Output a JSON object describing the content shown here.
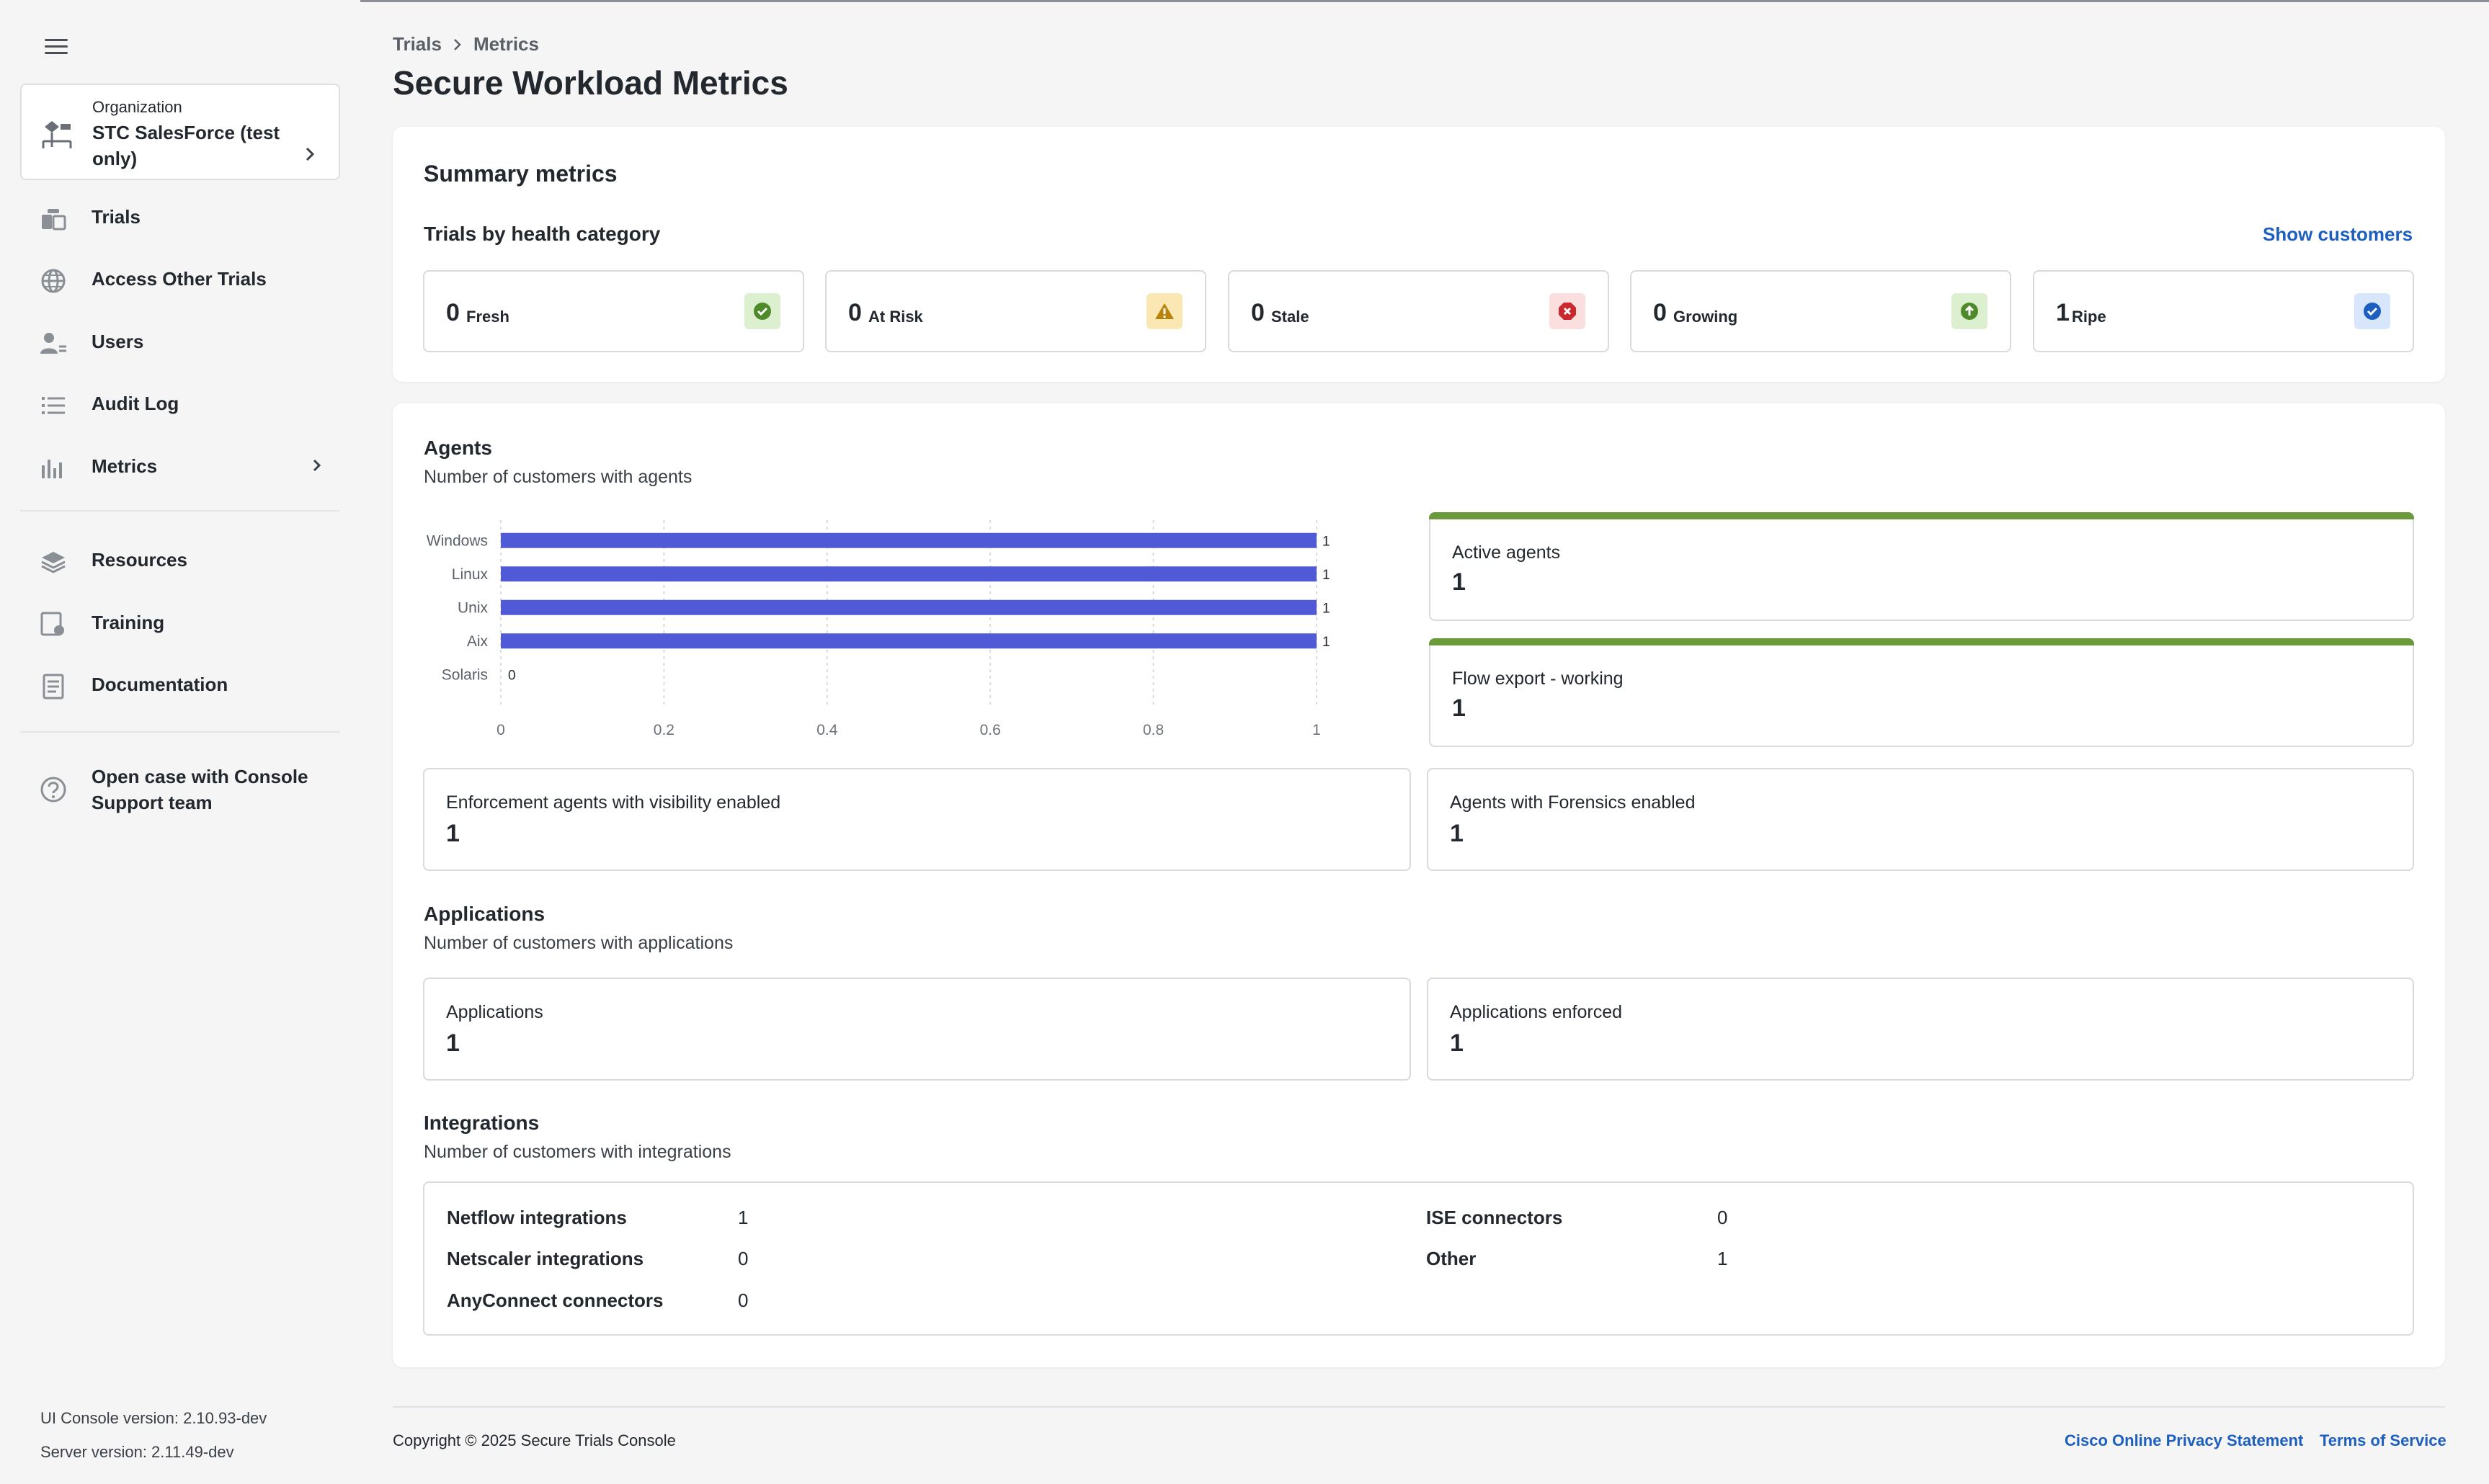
{
  "sidebar": {
    "org_small": "Organization",
    "org_name": "STC SalesForce (test only)",
    "items": [
      {
        "label": "Trials",
        "icon": "trials-icon"
      },
      {
        "label": "Access Other Trials",
        "icon": "globe-icon"
      },
      {
        "label": "Users",
        "icon": "users-icon"
      },
      {
        "label": "Audit Log",
        "icon": "list-icon"
      },
      {
        "label": "Metrics",
        "icon": "bar-chart-icon"
      },
      {
        "label": "Resources",
        "icon": "layers-icon"
      },
      {
        "label": "Training",
        "icon": "training-icon"
      },
      {
        "label": "Documentation",
        "icon": "document-icon"
      },
      {
        "label": "Open case with Console Support team",
        "icon": "help-icon"
      }
    ],
    "ui_version": "UI Console version: 2.10.93-dev",
    "server_version": "Server version: 2.11.49-dev"
  },
  "breadcrumb": {
    "root": "Trials",
    "current": "Metrics"
  },
  "page_title": "Secure Workload Metrics",
  "summary": {
    "title": "Summary metrics",
    "subtitle": "Trials by health category",
    "show_customers": "Show customers",
    "tiles": [
      {
        "count": "0",
        "label": "Fresh",
        "icon": "check-circle-icon",
        "bg": "#dcefcf",
        "fg": "#4f8a2a"
      },
      {
        "count": "0",
        "label": "At Risk",
        "icon": "warning-triangle-icon",
        "bg": "#fbe7b3",
        "fg": "#b8820b"
      },
      {
        "count": "0",
        "label": "Stale",
        "icon": "error-octagon-icon",
        "bg": "#fbdede",
        "fg": "#c8282e"
      },
      {
        "count": "0",
        "label": "Growing",
        "icon": "arrow-up-circle-icon",
        "bg": "#dcefcf",
        "fg": "#4f8a2a"
      },
      {
        "count": "1",
        "label": "Ripe",
        "icon": "check-badge-icon",
        "bg": "#d7e6fa",
        "fg": "#1d5fbf"
      }
    ]
  },
  "agents": {
    "title": "Agents",
    "subtitle": "Number of customers with agents",
    "active_agents": {
      "label": "Active agents",
      "value": "1"
    },
    "flow_export": {
      "label": "Flow export - working",
      "value": "1"
    },
    "enforcement": {
      "label": "Enforcement agents with visibility enabled",
      "value": "1"
    },
    "forensics": {
      "label": "Agents with Forensics enabled",
      "value": "1"
    },
    "accent": "#6a9a3a"
  },
  "chart_data": {
    "type": "bar",
    "orientation": "horizontal",
    "categories": [
      "Windows",
      "Linux",
      "Unix",
      "Aix",
      "Solaris"
    ],
    "values": [
      1,
      1,
      1,
      1,
      0
    ],
    "xlim": [
      0,
      1
    ],
    "xticks": [
      "0",
      "0.2",
      "0.4",
      "0.6",
      "0.8",
      "1"
    ],
    "grid": true,
    "color": "#5059d6"
  },
  "applications": {
    "title": "Applications",
    "subtitle": "Number of customers with applications",
    "applications": {
      "label": "Applications",
      "value": "1"
    },
    "enforced": {
      "label": "Applications enforced",
      "value": "1"
    }
  },
  "integrations": {
    "title": "Integrations",
    "subtitle": "Number of customers with integrations",
    "netflow": {
      "label": "Netflow integrations",
      "value": "1"
    },
    "netscaler": {
      "label": "Netscaler integrations",
      "value": "0"
    },
    "anyconnect": {
      "label": "AnyConnect connectors",
      "value": "0"
    },
    "ise": {
      "label": "ISE connectors",
      "value": "0"
    },
    "other": {
      "label": "Other",
      "value": "1"
    }
  },
  "footer": {
    "copyright": "Copyright © 2025 Secure Trials Console",
    "privacy": "Cisco Online Privacy Statement",
    "terms": "Terms of Service"
  }
}
